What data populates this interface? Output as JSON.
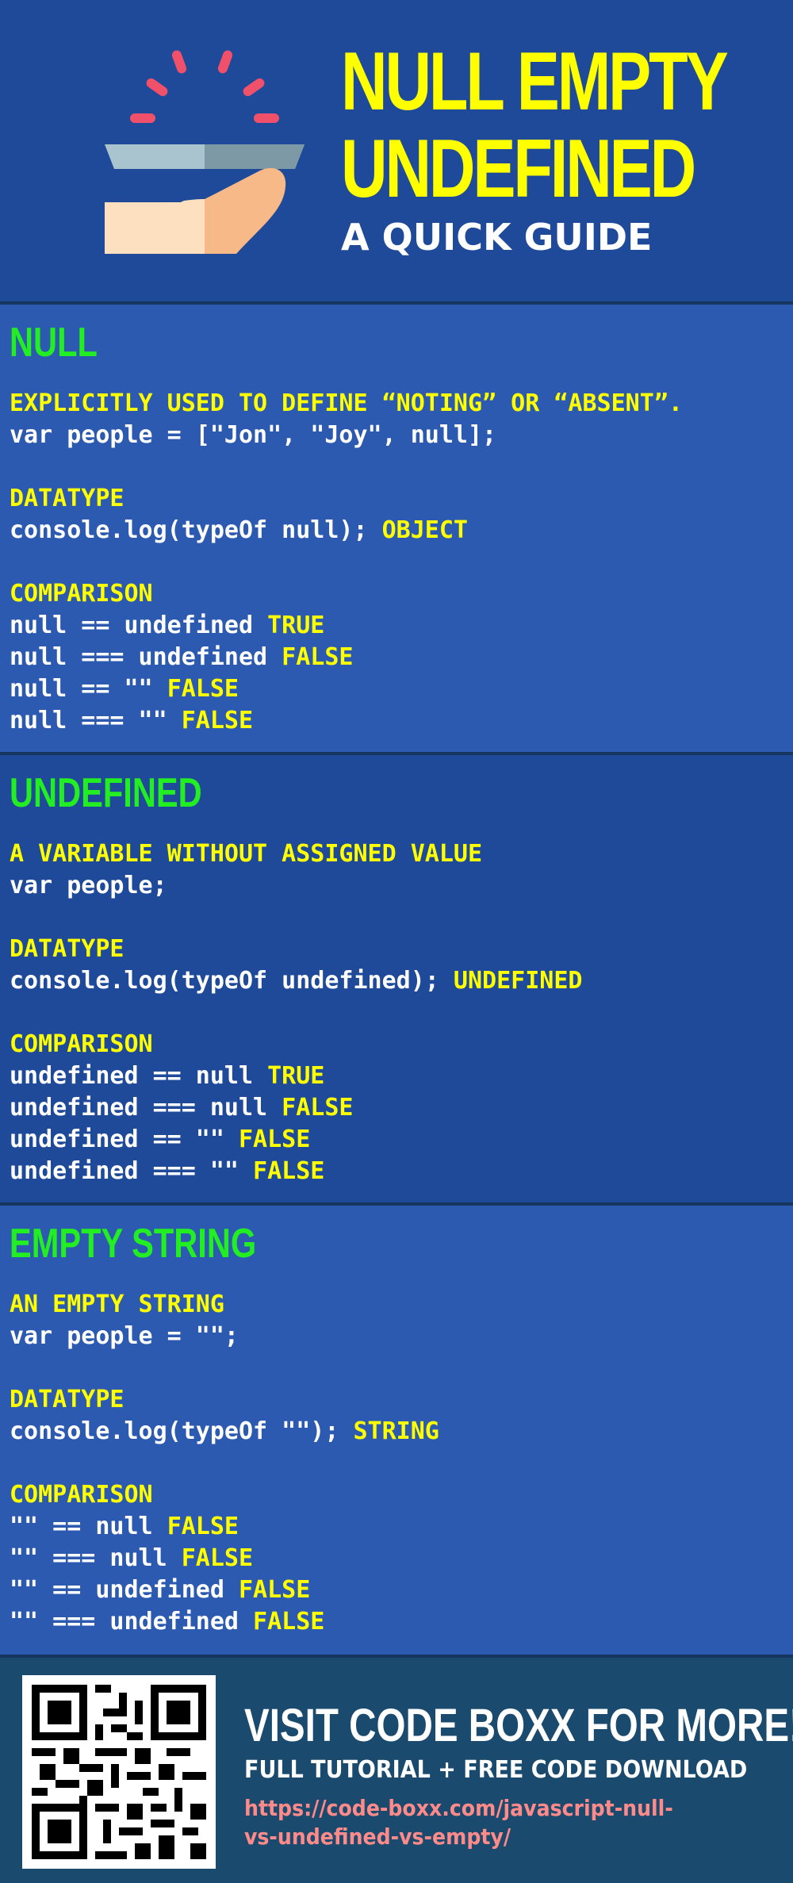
{
  "header": {
    "title_line1": "NULL EMPTY",
    "title_line2": "UNDEFINED",
    "subtitle": "A QUICK GUIDE",
    "illustration_icon": "hand-serving-tray-icon"
  },
  "sections": [
    {
      "title": "NULL",
      "definition": "EXPLICITLY USED TO DEFINE “NOTING” OR “ABSENT”.",
      "example": "var people = [\"Jon\", \"Joy\", null];",
      "datatype_label": "DATATYPE",
      "datatype_code": "console.log(typeOf null); ",
      "datatype_result": "OBJECT",
      "comparison_label": "COMPARISON",
      "comparisons": [
        {
          "code": "null == undefined ",
          "result": "TRUE"
        },
        {
          "code": "null === undefined ",
          "result": "FALSE"
        },
        {
          "code": "null == \"\" ",
          "result": "FALSE"
        },
        {
          "code": "null === \"\" ",
          "result": "FALSE"
        }
      ]
    },
    {
      "title": "UNDEFINED",
      "definition": "A VARIABLE WITHOUT ASSIGNED VALUE",
      "example": "var people;",
      "datatype_label": "DATATYPE",
      "datatype_code": "console.log(typeOf undefined); ",
      "datatype_result": "UNDEFINED",
      "comparison_label": "COMPARISON",
      "comparisons": [
        {
          "code": "undefined == null ",
          "result": "TRUE"
        },
        {
          "code": "undefined === null ",
          "result": "FALSE"
        },
        {
          "code": "undefined == \"\" ",
          "result": "FALSE"
        },
        {
          "code": "undefined === \"\" ",
          "result": "FALSE"
        }
      ]
    },
    {
      "title": "EMPTY STRING",
      "definition": "AN EMPTY STRING",
      "example": "var people = \"\";",
      "datatype_label": "DATATYPE",
      "datatype_code": "console.log(typeOf \"\"); ",
      "datatype_result": "STRING",
      "comparison_label": "COMPARISON",
      "comparisons": [
        {
          "code": "\"\" == null ",
          "result": "FALSE"
        },
        {
          "code": "\"\" === null ",
          "result": "FALSE"
        },
        {
          "code": "\"\" == undefined ",
          "result": "FALSE"
        },
        {
          "code": "\"\" === undefined ",
          "result": "FALSE"
        }
      ]
    }
  ],
  "footer": {
    "qr_icon": "qr-code-icon",
    "visit_text": "VISIT CODE BOXX FOR MORE!",
    "tutorial_text": "FULL TUTORIAL + FREE CODE DOWNLOAD",
    "link_url": "https://code-boxx.com/javascript-null-vs-undefined-vs-empty/"
  },
  "colors": {
    "background": "#1f4a9a",
    "section_alt": "#2c5ab0",
    "title_yellow": "#ffff00",
    "section_title_green": "#22ee22",
    "footer_bg": "#1a4a6e",
    "link_pink": "#ff8a8a"
  }
}
